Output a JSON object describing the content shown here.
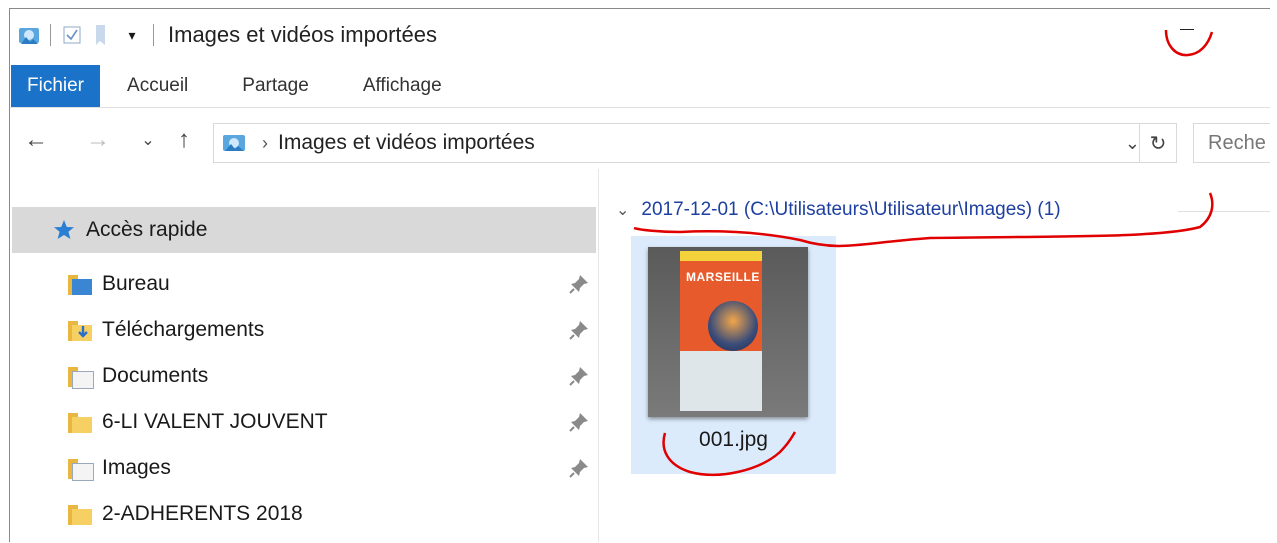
{
  "window": {
    "title": "Images et vidéos importées"
  },
  "ribbon": {
    "tabs": [
      "Fichier",
      "Accueil",
      "Partage",
      "Affichage"
    ]
  },
  "address": {
    "path": "Images et vidéos importées",
    "search_placeholder": "Reche"
  },
  "sidebar": {
    "quick_access": "Accès rapide",
    "items": [
      {
        "label": "Bureau",
        "pinned": true
      },
      {
        "label": "Téléchargements",
        "pinned": true
      },
      {
        "label": "Documents",
        "pinned": true
      },
      {
        "label": "6-LI VALENT JOUVENT",
        "pinned": true
      },
      {
        "label": "Images",
        "pinned": true
      },
      {
        "label": "2-ADHERENTS 2018",
        "pinned": false
      }
    ]
  },
  "content": {
    "group_header": "2017-12-01 (C:\\Utilisateurs\\Utilisateur\\Images) (1)",
    "files": [
      {
        "name": "001.jpg",
        "thumbnail_text": "MARSEILLE"
      }
    ]
  },
  "colors": {
    "accent": "#1a73c8",
    "selection": "#dcebfb",
    "annotation": "#e00000"
  }
}
